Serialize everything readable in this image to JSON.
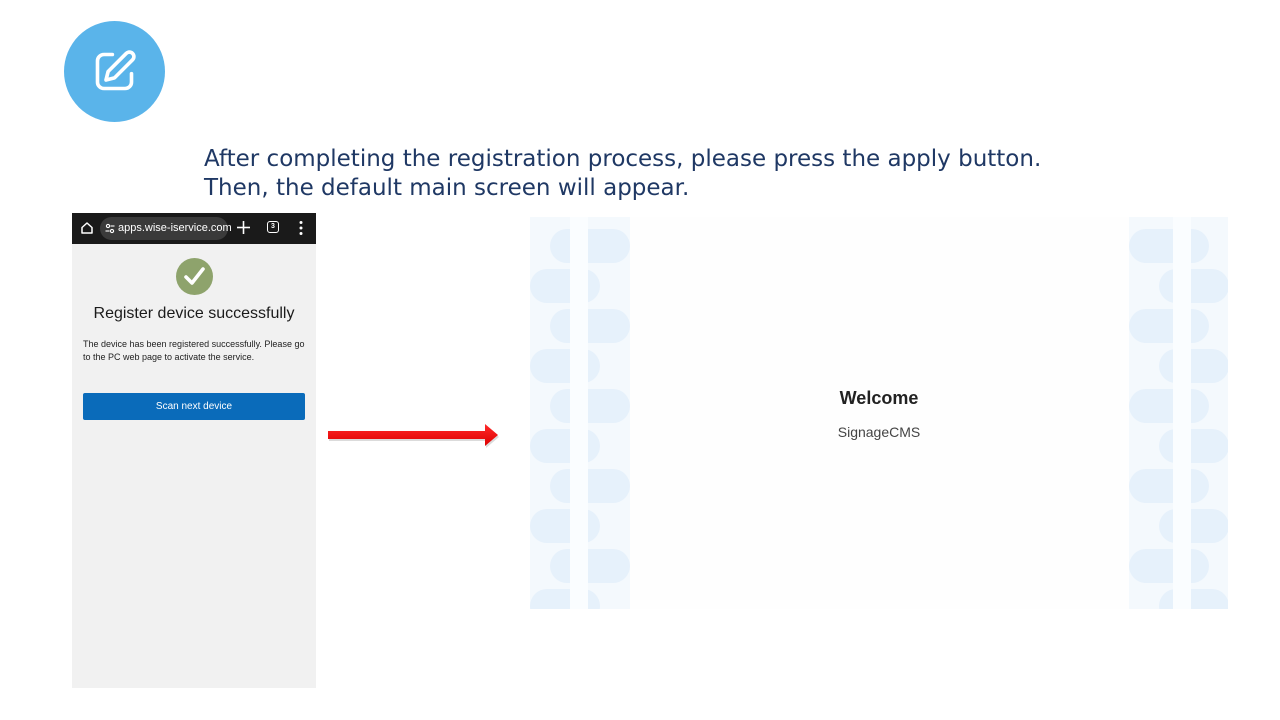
{
  "slide": {
    "instructions": {
      "line1": "After completing the registration process, please press the apply button.",
      "line2": "Then, the default main screen will appear."
    },
    "badge_icon": "edit-icon",
    "accent_color": "#5ab4ea",
    "text_color": "#1f3864"
  },
  "phone": {
    "browser": {
      "url": "apps.wise-iservice.com",
      "tab_count": "3"
    },
    "status_icon": "check-circle-icon",
    "title": "Register device successfully",
    "description": "The device has been registered successfully. Please go to the PC web page to activate the service.",
    "scan_button_label": "Scan next device",
    "button_color": "#0a6bba"
  },
  "arrow_color": "#ee0000",
  "main_screen": {
    "title": "Welcome",
    "subtitle": "SignageCMS"
  }
}
